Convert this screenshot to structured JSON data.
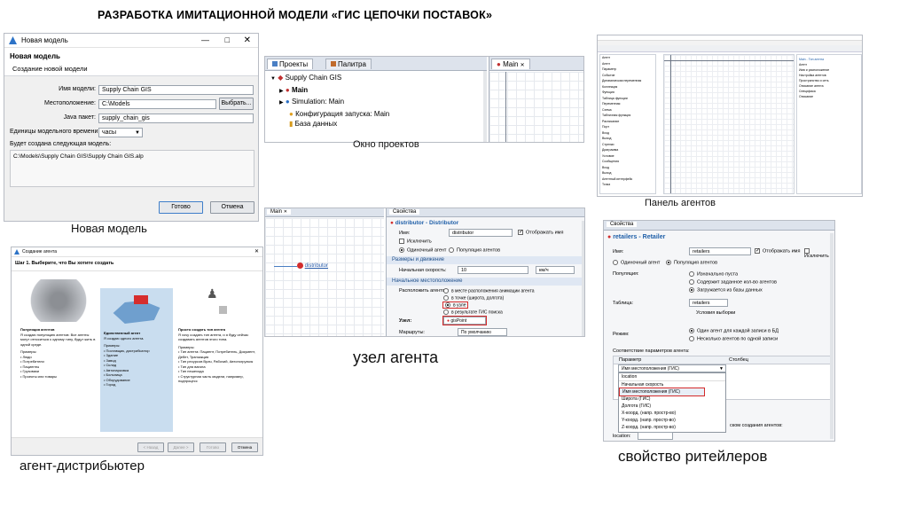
{
  "page_title": "РАЗРАБОТКА ИМИТАЦИОННОЙ МОДЕЛИ «ГИС ЦЕПОЧКИ ПОСТАВОК»",
  "captions": {
    "new_model": "Новая модель",
    "projects_window": "Окно проектов",
    "agents_panel": "Панель агентов",
    "agent_node": "узел агента",
    "distributor_agent": "агент-дистрибьютер",
    "retailer_props": "свойство ритейлеров"
  },
  "new_model_dialog": {
    "window_title": "Новая модель",
    "heading": "Новая модель",
    "subheading": "Создание новой модели",
    "fields": [
      {
        "label": "Имя модели:",
        "value": "Supply Chain GIS"
      },
      {
        "label": "Местоположение:",
        "value": "C:\\Models"
      },
      {
        "label": "Java пакет:",
        "value": "supply_chain_gis"
      },
      {
        "label": "Единицы модельного времени:",
        "value": "часы"
      }
    ],
    "browse_button": "Выбрать...",
    "will_create_label": "Будет создана следующая модель:",
    "path": "C:\\Models\\Supply Chain GIS\\Supply Chain GIS.alp",
    "ok_button": "Готово",
    "cancel_button": "Отмена"
  },
  "projects_panel": {
    "tab_projects": "Проекты",
    "tab_palette": "Палитра",
    "tab_main": "Main",
    "tree": [
      {
        "label": "Supply Chain GIS",
        "level": 0
      },
      {
        "label": "Main",
        "level": 1
      },
      {
        "label": "Simulation: Main",
        "level": 1
      },
      {
        "label": "Конфигурация запуска: Main",
        "level": 1
      },
      {
        "label": "База данных",
        "level": 1
      }
    ]
  },
  "agents_panel": {
    "items": [
      "Агент",
      "Агент",
      "Параметр",
      "Событие",
      "Динамическая переменная",
      "Коллекция",
      "Функция",
      "Таблица функции",
      "Переменная",
      "Схема",
      "Табличная функция",
      "Расписание",
      "Порт",
      "Вход",
      "Выход",
      "Стрелки",
      "Диаграмма",
      "Условие",
      "Сообщения",
      "Вход",
      "Выход",
      "Агентный интерфейс",
      "Точка"
    ],
    "right_items": [
      "Main - Тип агента",
      "Агент",
      "Имя и расположение",
      "Настройка агентов",
      "Пространство и сеть",
      "Описание агента",
      "Специфика",
      "Описание"
    ]
  },
  "create_agent_wizard": {
    "window_title": "Создание агента",
    "step": "Шаг 1. Выберите, что Вы хотите создать",
    "options": [
      {
        "title": "Популяция агентов",
        "desc": "Я создаю популяцию агентов: Все агенты могут относиться к одному типу, будут жить в одной среде.",
        "examples_label": "Примеры:",
        "examples": [
          "Люди",
          "Потребители",
          "Пациенты",
          "Грузовики",
          "Проекты или товары"
        ]
      },
      {
        "title": "Единственный агент",
        "desc": "Я создаю одного агента.",
        "examples_label": "Примеры:",
        "examples": [
          "Поставщик, дистрибьютор",
          "Здание",
          "Завод",
          "Склад",
          "Автопарковка",
          "Больница",
          "Оборудование",
          "Город"
        ]
      },
      {
        "title": "Просто создать тип агента",
        "desc": "Я хочу создать тип агента, и я буду сейчас создавать агентов этого типа.",
        "examples_label": "Примеры:",
        "examples": [
          "Тип агента: Пациент, Потребитель, Документ, Дебет, Транзакция",
          "Тип ресурсов Врач, Рабочий, Автопогрузчик",
          "Тип для вагона",
          "Тип пешехода",
          "Структурная часть модели, например, подпроцесс"
        ]
      }
    ],
    "back_button": "< Назад",
    "next_button": "Далее >",
    "finish_button": "Готово",
    "cancel_button": "Отмена"
  },
  "distributor_panel": {
    "main_tab": "Main",
    "node_label": "distributor",
    "props_tab": "Свойства",
    "header": "distributor - Distributor",
    "name_label": "Имя:",
    "name_value": "distributor",
    "show_name": "Отображать имя",
    "exclude": "Исключить",
    "single_agent": "Одиночный агент",
    "population": "Популяция агентов",
    "section_dimensions": "Размеры и движение",
    "speed_label": "Начальная скорость:",
    "speed_value": "10",
    "speed_unit": "км/ч",
    "section_location": "Начальное местоположение",
    "place_label": "Расположить агентов:",
    "place_options": [
      "в месте расположения анимации агента",
      "в точке (широта, долгота)",
      "в узле",
      "в результате ГИС поиска"
    ],
    "node_field_label": "Узел:",
    "node_value": "gisPoint",
    "routes_label": "Маршруты:",
    "routes_value": "По умолчанию"
  },
  "retailers_panel": {
    "props_tab": "Свойства",
    "header": "retailers - Retailer",
    "name_label": "Имя:",
    "name_value": "retailers",
    "show_name": "Отображать имя",
    "exclude": "Исключить",
    "single_agent": "Одиночный агент",
    "population": "Популяция агентов",
    "population_label": "Популяция:",
    "population_options": [
      "Изначально пуста",
      "Содержит заданное кол-во агентов",
      "Загружается из базы данных"
    ],
    "table_label": "Таблица:",
    "table_value": "retailers",
    "filter_label": "Условия выборки",
    "mode_label": "Режим:",
    "mode_options": [
      "Один агент для каждой записи в БД",
      "Несколько агентов по одной записи"
    ],
    "params_label": "Соответствие параметров агента:",
    "col_param": "Параметр",
    "col_column": "Столбец",
    "dropdown_value": "Имя местоположения (ГИС)",
    "dropdown_items": [
      "location",
      "Начальная скорость",
      "Имя местоположения (ГИС)",
      "Широта (ГИС)",
      "Долгота (ГИС)",
      "X-коорд. (напр. простр-во)",
      "Y-коорд. (напр. простр-во)",
      "Z-коорд. (напр. простр-во)"
    ],
    "tail_text": "ском создания агентов:",
    "location_label": "location:"
  }
}
